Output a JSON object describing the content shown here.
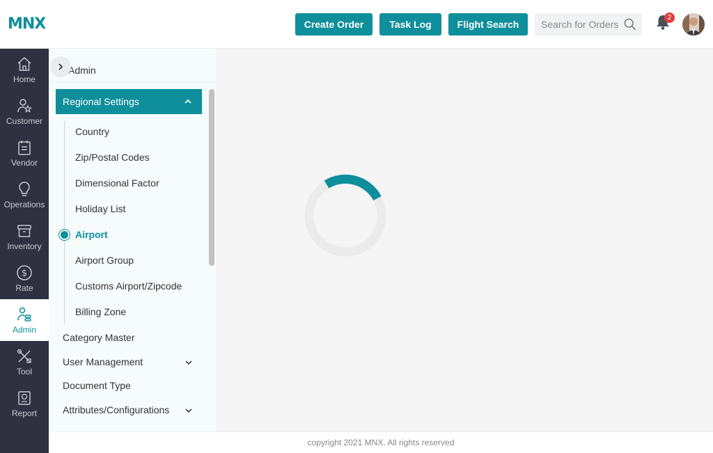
{
  "brand": {
    "logo_text": "MNX",
    "accent_color": "#0e8f9b",
    "rail_bg": "#2f3140"
  },
  "header": {
    "buttons": {
      "create_order": "Create Order",
      "task_log": "Task Log",
      "flight_search": "Flight Search"
    },
    "search": {
      "placeholder": "Search for Orders",
      "icon": "search-icon"
    },
    "notifications": {
      "icon": "bell-icon",
      "count": "2"
    },
    "avatar": {
      "icon": "user-avatar"
    }
  },
  "rail": {
    "items": [
      {
        "label": "Home",
        "icon": "home-icon"
      },
      {
        "label": "Customer",
        "icon": "customer-icon"
      },
      {
        "label": "Vendor",
        "icon": "vendor-icon"
      },
      {
        "label": "Operations",
        "icon": "lightbulb-icon"
      },
      {
        "label": "Inventory",
        "icon": "archive-icon"
      },
      {
        "label": "Rate",
        "icon": "dollar-icon"
      },
      {
        "label": "Admin",
        "icon": "admin-icon",
        "active": true
      },
      {
        "label": "Tool",
        "icon": "tools-icon"
      },
      {
        "label": "Report",
        "icon": "report-icon"
      }
    ]
  },
  "submenu": {
    "title": "Admin",
    "group": {
      "label": "Regional Settings",
      "expanded": true,
      "items": [
        {
          "label": "Country"
        },
        {
          "label": "Zip/Postal Codes"
        },
        {
          "label": "Dimensional Factor"
        },
        {
          "label": "Holiday List"
        },
        {
          "label": "Airport",
          "active": true
        },
        {
          "label": "Airport Group"
        },
        {
          "label": "Customs Airport/Zipcode"
        },
        {
          "label": "Billing Zone"
        }
      ]
    },
    "items": [
      {
        "label": "Category Master",
        "has_children": false
      },
      {
        "label": "User Management",
        "has_children": true
      },
      {
        "label": "Document Type",
        "has_children": false
      },
      {
        "label": "Attributes/Configurations",
        "has_children": true
      }
    ]
  },
  "main": {
    "loading": true
  },
  "footer": {
    "text": "copyright 2021 MNX. All rights reserved"
  }
}
